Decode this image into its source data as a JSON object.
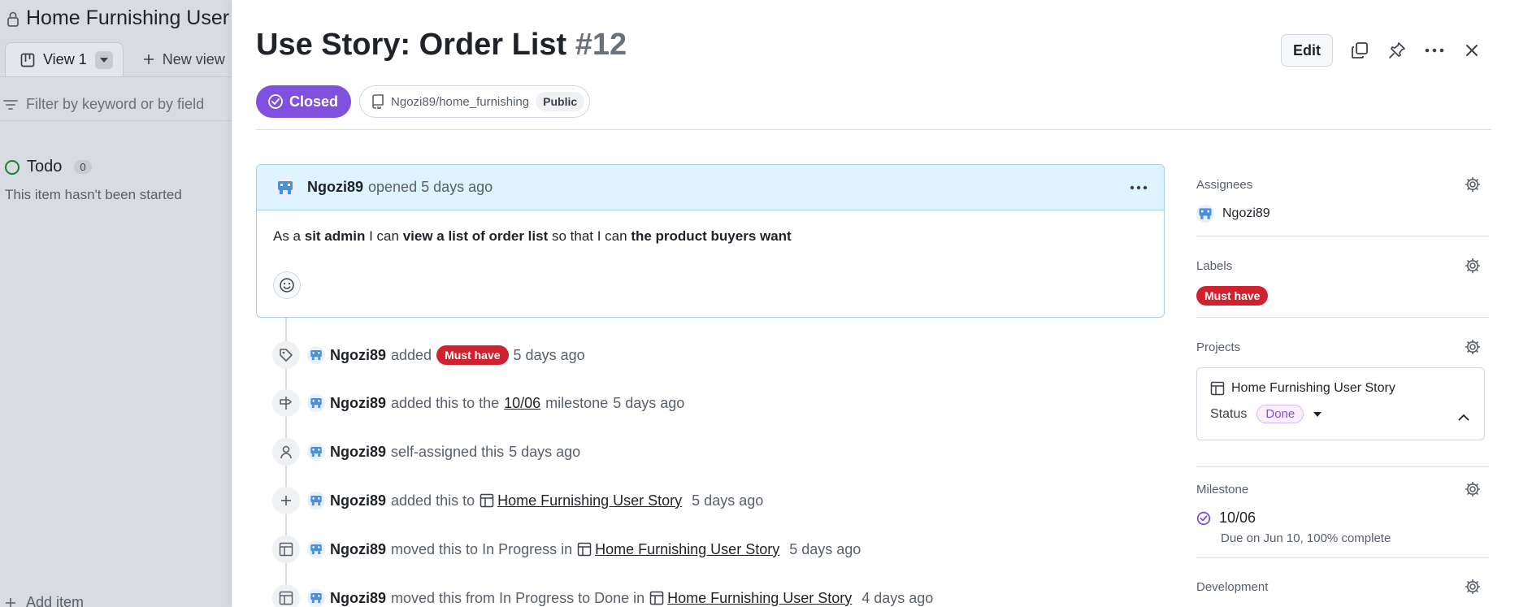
{
  "board": {
    "title": "Home Furnishing User Story",
    "tab_active": "View 1",
    "tab_new": "New view",
    "filter_placeholder": "Filter by keyword or by field",
    "column": {
      "name": "Todo",
      "count": "0",
      "description": "This item hasn't been started"
    },
    "add_item": "Add item"
  },
  "issue": {
    "title": "Use Story: Order List",
    "number": "#12",
    "edit_label": "Edit",
    "state": "Closed",
    "repo": "Ngozi89/home_furnishing",
    "visibility": "Public"
  },
  "comment": {
    "author": "Ngozi89",
    "opened": "opened 5 days ago",
    "body": {
      "p1": "As a ",
      "b1": "sit admin",
      "p2": " I can ",
      "b2": "view a list of order list",
      "p3": " so that I can ",
      "b3": "the product buyers want"
    }
  },
  "timeline": [
    {
      "icon": "tag-icon",
      "user": "Ngozi89",
      "text": "added",
      "label": "Must have",
      "time": "5 days ago"
    },
    {
      "icon": "milestone-icon",
      "user": "Ngozi89",
      "text": "added this to the",
      "link": "10/06",
      "text2": "milestone",
      "time": "5 days ago"
    },
    {
      "icon": "person-icon",
      "user": "Ngozi89",
      "text": "self-assigned this",
      "time": "5 days ago"
    },
    {
      "icon": "plus-icon",
      "user": "Ngozi89",
      "text": "added this to",
      "project": "Home Furnishing User Story",
      "time": "5 days ago"
    },
    {
      "icon": "table-icon",
      "user": "Ngozi89",
      "text": "moved this to In Progress in",
      "project": "Home Furnishing User Story",
      "time": "5 days ago"
    },
    {
      "icon": "table-icon",
      "user": "Ngozi89",
      "text": "moved this from In Progress to Done in",
      "project": "Home Furnishing User Story",
      "time": "4 days ago"
    }
  ],
  "sidebar": {
    "assignees": {
      "heading": "Assignees",
      "user": "Ngozi89"
    },
    "labels": {
      "heading": "Labels",
      "label": "Must have"
    },
    "projects": {
      "heading": "Projects",
      "project": "Home Furnishing User Story",
      "status_label": "Status",
      "status_value": "Done"
    },
    "milestone": {
      "heading": "Milestone",
      "name": "10/06",
      "due": "Due on Jun 10, 100% complete"
    },
    "development": {
      "heading": "Development"
    }
  },
  "colors": {
    "closed": "#8250df",
    "label_red": "#cf222e",
    "comment_head": "#ddf4ff",
    "board_bg": "#d8dbe0"
  }
}
